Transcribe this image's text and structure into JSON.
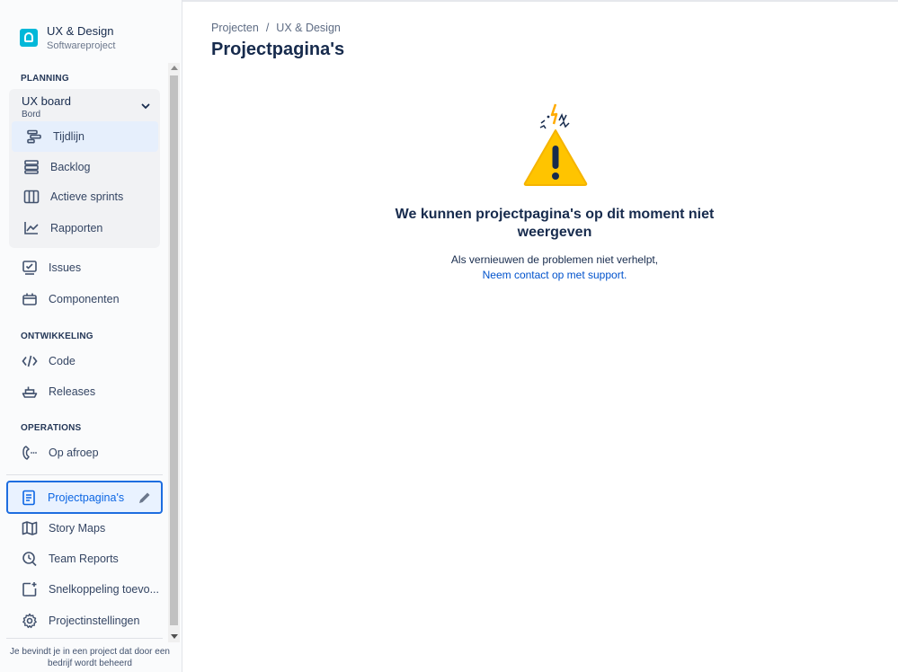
{
  "project": {
    "name": "UX & Design",
    "type": "Softwareproject",
    "avatar_color": "#00b8d9"
  },
  "sidebar": {
    "sections": {
      "planning": "PLANNING",
      "development": "ONTWIKKELING",
      "operations": "OPERATIONS"
    },
    "board": {
      "name": "UX board",
      "subtitle": "Bord",
      "icon": "chevron-down-icon",
      "items": [
        {
          "label": "Tijdlijn",
          "icon": "timeline-icon",
          "selected": true
        },
        {
          "label": "Backlog",
          "icon": "backlog-icon"
        },
        {
          "label": "Actieve sprints",
          "icon": "board-columns-icon"
        },
        {
          "label": "Rapporten",
          "icon": "chart-line-icon"
        }
      ]
    },
    "planning_items": [
      {
        "label": "Issues",
        "icon": "issues-icon"
      },
      {
        "label": "Componenten",
        "icon": "component-icon"
      }
    ],
    "development_items": [
      {
        "label": "Code",
        "icon": "code-icon"
      },
      {
        "label": "Releases",
        "icon": "ship-icon"
      }
    ],
    "operations_items": [
      {
        "label": "Op afroep",
        "icon": "phone-icon"
      }
    ],
    "bottom_items": [
      {
        "label": "Projectpagina's",
        "icon": "page-icon",
        "active": true
      },
      {
        "label": "Story Maps",
        "icon": "map-icon"
      },
      {
        "label": "Team Reports",
        "icon": "team-report-icon"
      },
      {
        "label": "Snelkoppeling toevo...",
        "icon": "add-shortcut-icon"
      },
      {
        "label": "Projectinstellingen",
        "icon": "gear-icon"
      }
    ],
    "footer_note": "Je bevindt je in een project dat door een bedrijf wordt beheerd"
  },
  "breadcrumb": {
    "items": [
      "Projecten",
      "UX & Design"
    ],
    "separator": "/"
  },
  "main": {
    "title": "Projectpagina's",
    "error": {
      "title": "We kunnen projectpagina's op dit moment niet weergeven",
      "text": "Als vernieuwen de problemen niet verhelpt,",
      "link": "Neem contact op met support",
      "link_suffix": "."
    }
  },
  "colors": {
    "accent": "#0c66e4",
    "link": "#0052cc",
    "warning": "#ffc400"
  }
}
